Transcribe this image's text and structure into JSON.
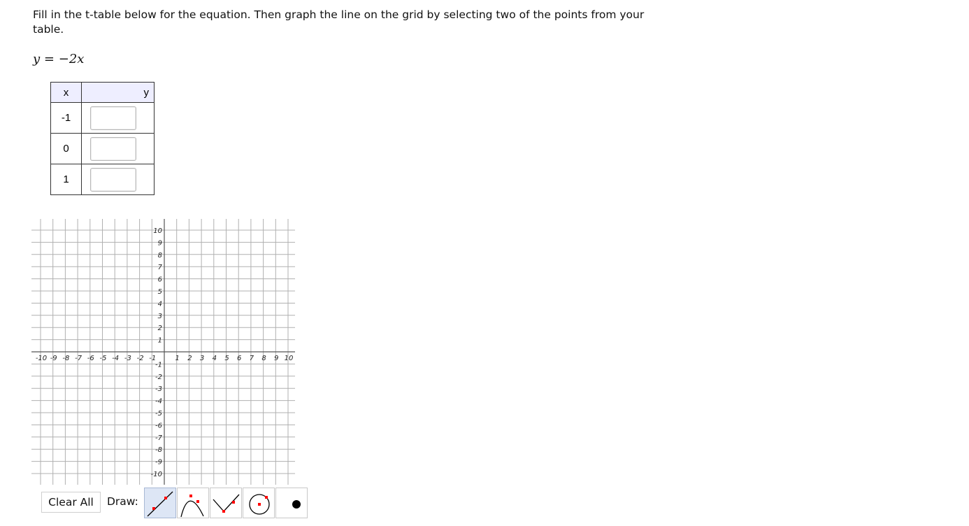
{
  "instructions": "Fill in the t-table below for the equation. Then graph the line on the grid by selecting two of the points from your table.",
  "equation": {
    "lhs": "y",
    "equals": "=",
    "rhs": "−2x"
  },
  "ttable": {
    "headers": {
      "x": "x",
      "y": "y"
    },
    "rows": [
      {
        "x": "-1",
        "y": ""
      },
      {
        "x": "0",
        "y": ""
      },
      {
        "x": "1",
        "y": ""
      }
    ]
  },
  "graph": {
    "x_range": [
      -10,
      10
    ],
    "y_range": [
      -10,
      10
    ],
    "grid": true,
    "x_tick_labels": [
      "-10",
      "-9",
      "-8",
      "-7",
      "-6",
      "-5",
      "-4",
      "-3",
      "-2",
      "-1",
      "1",
      "2",
      "3",
      "4",
      "5",
      "6",
      "7",
      "8",
      "9",
      "10"
    ],
    "y_tick_labels": [
      "10",
      "9",
      "8",
      "7",
      "6",
      "5",
      "4",
      "3",
      "2",
      "1",
      "-1",
      "-2",
      "-3",
      "-4",
      "-5",
      "-6",
      "-7",
      "-8",
      "-9",
      "-10"
    ]
  },
  "toolbar": {
    "clear_label": "Clear All",
    "draw_label": "Draw:",
    "tools": [
      {
        "name": "line-tool",
        "icon": "line-icon",
        "selected": true
      },
      {
        "name": "parabola-tool",
        "icon": "parabola-icon",
        "selected": false
      },
      {
        "name": "absolute-value-tool",
        "icon": "absolute-value-icon",
        "selected": false
      },
      {
        "name": "circle-tool",
        "icon": "circle-icon",
        "selected": false
      },
      {
        "name": "point-tool",
        "icon": "point-icon",
        "selected": false
      }
    ]
  },
  "colors": {
    "accent": "#ff0000",
    "grid": "#b0b0b0",
    "axis": "#555555",
    "header_bg": "#eeeeff",
    "tool_selected": "#dde6f5"
  }
}
